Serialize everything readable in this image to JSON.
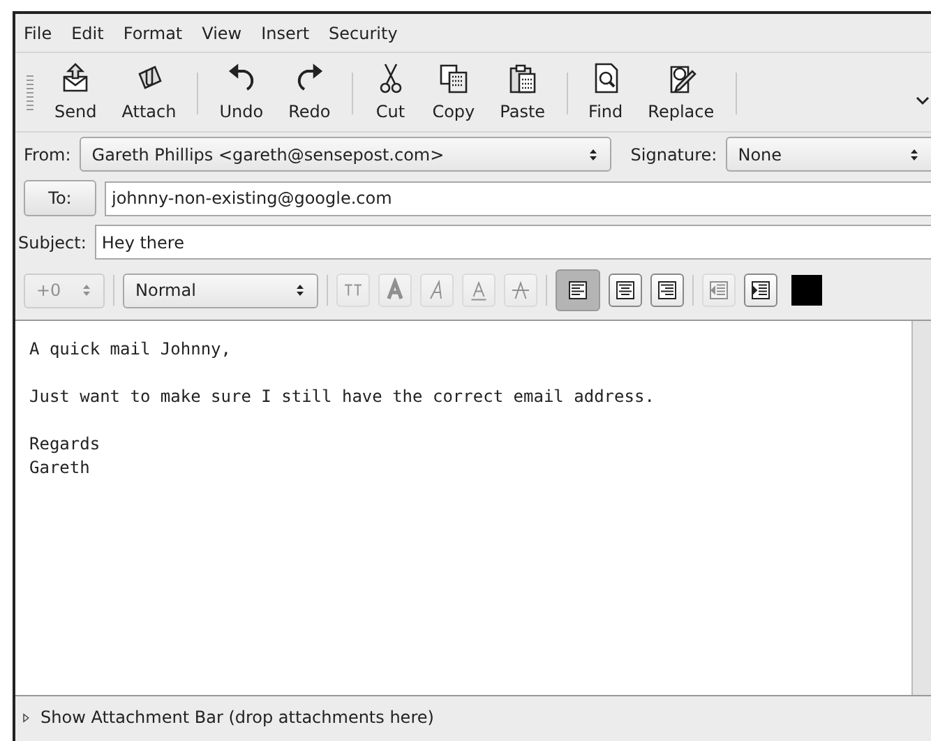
{
  "menu": [
    "File",
    "Edit",
    "Format",
    "View",
    "Insert",
    "Security"
  ],
  "toolbar_groups": [
    [
      "Send",
      "Attach"
    ],
    [
      "Undo",
      "Redo"
    ],
    [
      "Cut",
      "Copy",
      "Paste"
    ],
    [
      "Find",
      "Replace"
    ]
  ],
  "from": {
    "label": "From:",
    "value": "Gareth Phillips <gareth@sensepost.com>"
  },
  "signature": {
    "label": "Signature:",
    "value": "None"
  },
  "to": {
    "label": "To:",
    "value": "johnny-non-existing@google.com"
  },
  "subject": {
    "label": "Subject:",
    "value": "Hey there"
  },
  "format_bar": {
    "size": {
      "value": "+0",
      "disabled": true
    },
    "style": "Normal",
    "buttons": [
      {
        "kind": "smaller",
        "disabled": true,
        "selected": false
      },
      {
        "kind": "bold",
        "disabled": true,
        "selected": false
      },
      {
        "kind": "italic",
        "disabled": true,
        "selected": false
      },
      {
        "kind": "underline",
        "disabled": true,
        "selected": false
      },
      {
        "kind": "strike",
        "disabled": true,
        "selected": false
      },
      {
        "kind": "align-left",
        "disabled": false,
        "selected": true
      },
      {
        "kind": "align-center",
        "disabled": false,
        "selected": false
      },
      {
        "kind": "align-right",
        "disabled": false,
        "selected": false
      },
      {
        "kind": "outdent",
        "disabled": true,
        "selected": false
      },
      {
        "kind": "indent",
        "disabled": false,
        "selected": false
      }
    ],
    "text_color_disabled": false
  },
  "body": [
    [
      "A quick mail Johnny,"
    ],
    [
      "Just want to make sure I still have the correct email address."
    ],
    [
      "Regards",
      "Gareth"
    ]
  ],
  "attachment_bar": {
    "label": "Show Attachment Bar (drop attachments here)",
    "expanded": false
  }
}
